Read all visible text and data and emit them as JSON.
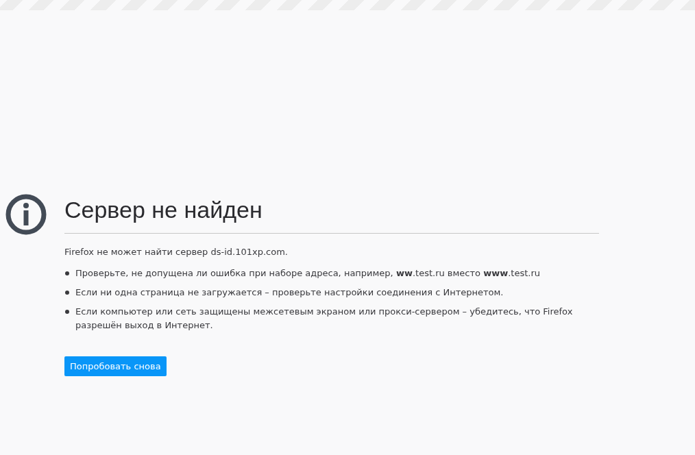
{
  "title": "Сервер не найден",
  "description": "Firefox не может найти сервер ds-id.101xp.com.",
  "suggestions": [
    "Проверьте, не допущена ли ошибка при наборе адреса, например, **ww**.test.ru вместо **www**.test.ru",
    "Если ни одна страница не загружается – проверьте настройки соединения с Интернетом.",
    "Если компьютер или сеть защищены межсетевым экраном или прокси-сервером – убедитесь, что Firefox разрешён выход в Интернет."
  ],
  "button": "Попробовать снова"
}
